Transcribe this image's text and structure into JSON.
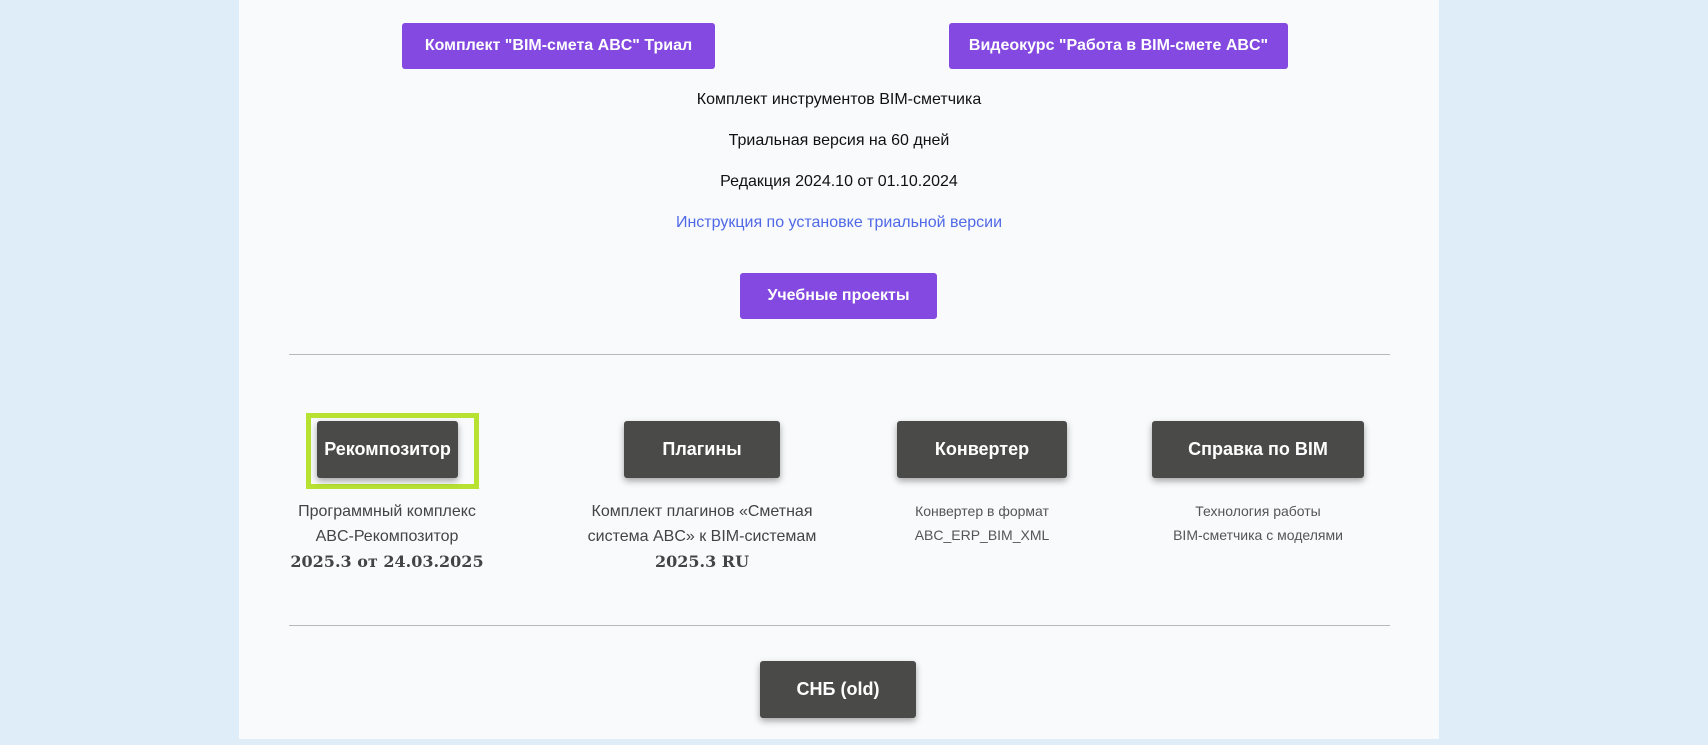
{
  "top_buttons": {
    "trial_label": "Комплект \"BIM-смета ABC\" Триал",
    "video_label": "Видеокурс \"Работа в BIM-смете ABC\""
  },
  "info": {
    "line1": "Комплект инструментов BIM-сметчика",
    "line2": "Триальная версия на 60 дней",
    "line3": "Редакция 2024.10 от 01.10.2024",
    "install_link": "Инструкция по установке триальной версии"
  },
  "edu_button": "Учебные проекты",
  "products": [
    {
      "label": "Рекомпозитор",
      "desc1": "Программный комплекс",
      "desc2": "ABC-Рекомпозитор",
      "version": "2025.3 от 24.03.2025"
    },
    {
      "label": "Плагины",
      "desc1": "Комплект плагинов «Сметная",
      "desc2": "система ABC» к BIM-системам",
      "version": "2025.3 RU"
    },
    {
      "label": "Конвертер",
      "desc1": "Конвертер в формат",
      "desc2": "ABC_ERP_BIM_XML"
    },
    {
      "label": "Справка по BIM",
      "desc1": "Технология работы",
      "desc2": "BIM-сметчика с моделями"
    }
  ],
  "snb_button": "СНБ (old)",
  "colors": {
    "purple_button": "#8449e0",
    "dark_button": "#4a4a49",
    "highlight": "#b8e232",
    "link": "#5069e6",
    "page_background": "#deedf8"
  }
}
